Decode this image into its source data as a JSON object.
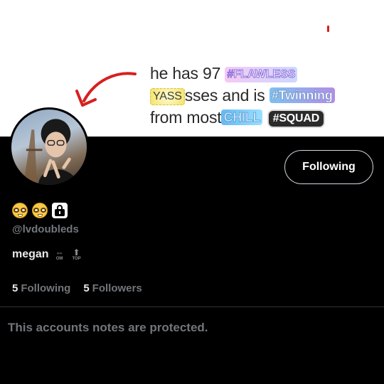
{
  "header": {
    "meme_line1_prefix": "he has 97",
    "meme_badge_flawless": "#FLAWLESS",
    "meme_badge_yass": "YASS",
    "meme_line2_text": "sses and is",
    "meme_badge_twinning": "#Twinning",
    "meme_line3_prefix": "from most",
    "meme_badge_chill": "CHILL",
    "meme_badge_squad": "#SQUAD"
  },
  "profile": {
    "follow_button_label": "Following",
    "handle": "@lvdoubleds",
    "display_name": "megan",
    "name_icons": [
      {
        "glyph": "⇔",
        "caption": "OM"
      },
      {
        "glyph": "⬆",
        "caption": "TOP"
      }
    ],
    "stats": {
      "following_count": "5",
      "following_label": "Following",
      "followers_count": "5",
      "followers_label": "Followers"
    },
    "protected_notice": "This accounts notes are protected."
  },
  "colors": {
    "background": "#000000",
    "muted_text": "#71767b",
    "primary_text": "#e7e9ea",
    "button_border": "#cfd9de",
    "arrow": "#d62020"
  },
  "icons": {
    "emoji_row": [
      "nerd-face-icon",
      "nerd-face-icon",
      "lock-icon"
    ]
  }
}
